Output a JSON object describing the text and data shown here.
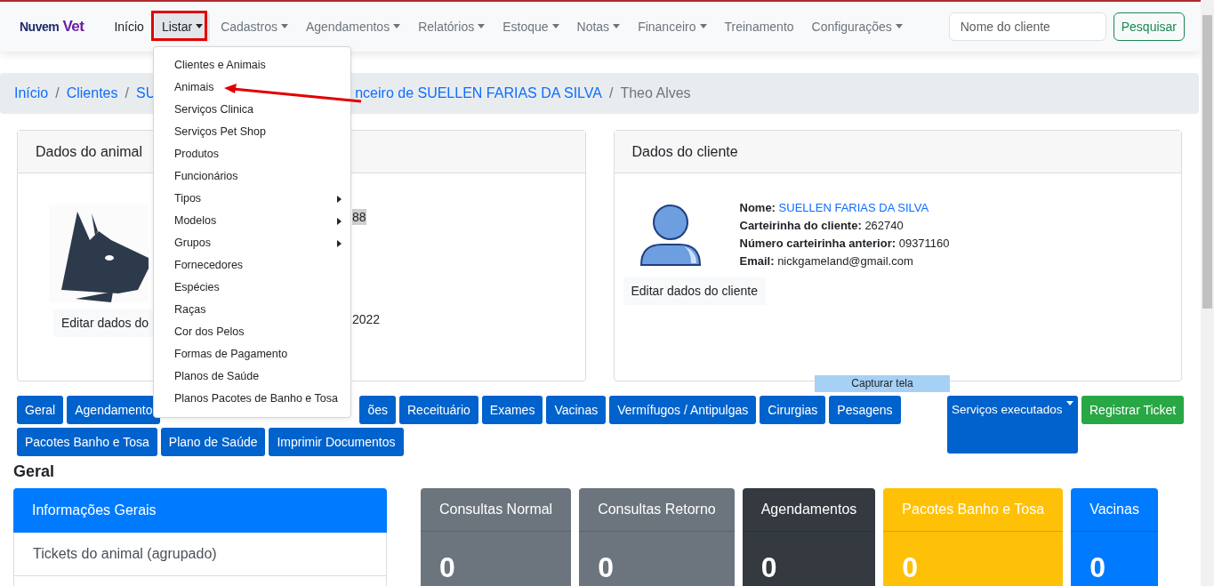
{
  "navbar": {
    "brand": {
      "first": "Nuvem",
      "second": "Vet"
    },
    "items": [
      {
        "label": "Início",
        "dropdown": false,
        "active": true,
        "open": false
      },
      {
        "label": "Listar",
        "dropdown": true,
        "active": true,
        "open": true
      },
      {
        "label": "Cadastros",
        "dropdown": true,
        "active": false,
        "open": false
      },
      {
        "label": "Agendamentos",
        "dropdown": true,
        "active": false,
        "open": false
      },
      {
        "label": "Relatórios",
        "dropdown": true,
        "active": false,
        "open": false
      },
      {
        "label": "Estoque",
        "dropdown": true,
        "active": false,
        "open": false
      },
      {
        "label": "Notas",
        "dropdown": true,
        "active": false,
        "open": false
      },
      {
        "label": "Financeiro",
        "dropdown": true,
        "active": false,
        "open": false
      },
      {
        "label": "Treinamento",
        "dropdown": false,
        "active": false,
        "open": false
      },
      {
        "label": "Configurações",
        "dropdown": true,
        "active": false,
        "open": false
      }
    ],
    "search": {
      "placeholder": "Nome do cliente"
    },
    "search_button": "Pesquisar"
  },
  "dropdown_menu": {
    "items": [
      {
        "label": "Clientes e Animais",
        "submenu": false
      },
      {
        "label": "Animais",
        "submenu": false
      },
      {
        "label": "Serviços Clinica",
        "submenu": false
      },
      {
        "label": "Serviços Pet Shop",
        "submenu": false
      },
      {
        "label": "Produtos",
        "submenu": false
      },
      {
        "label": "Funcionários",
        "submenu": false
      },
      {
        "label": "Tipos",
        "submenu": true
      },
      {
        "label": "Modelos",
        "submenu": true
      },
      {
        "label": "Grupos",
        "submenu": true
      },
      {
        "label": "Fornecedores",
        "submenu": false
      },
      {
        "label": "Espécies",
        "submenu": false
      },
      {
        "label": "Raças",
        "submenu": false
      },
      {
        "label": "Cor dos Pelos",
        "submenu": false
      },
      {
        "label": "Formas de Pagamento",
        "submenu": false
      },
      {
        "label": "Planos de Saúde",
        "submenu": false
      },
      {
        "label": "Planos Pacotes de Banho e Tosa",
        "submenu": false
      }
    ]
  },
  "breadcrumb": {
    "separator": "/",
    "items": [
      {
        "label": "Início",
        "link": true
      },
      {
        "label": "Clientes",
        "link": true
      },
      {
        "label": "SU",
        "link": true
      },
      {
        "label": "nceiro de SUELLEN FARIAS DA SILVA",
        "link": true
      },
      {
        "label": "Theo Alves",
        "link": false
      }
    ]
  },
  "animal_card": {
    "title": "Dados do animal",
    "fields": [
      {
        "text": "88",
        "highlighted": true
      },
      {
        "text": "2022",
        "highlighted": false
      }
    ],
    "edit_button": "Editar dados do"
  },
  "client_card": {
    "title": "Dados do cliente",
    "fields": [
      {
        "label": "Nome:",
        "value": "SUELLEN FARIAS DA SILVA",
        "link": true
      },
      {
        "label": "Carteirinha do cliente:",
        "value": "262740",
        "link": false
      },
      {
        "label": "Número carteirinha anterior:",
        "value": "09371160",
        "link": false
      },
      {
        "label": "Email:",
        "value": "nickgameland@gmail.com",
        "link": false
      }
    ],
    "edit_button": "Editar dados do cliente"
  },
  "action_buttons": {
    "first_line": [
      {
        "label": "Geral"
      },
      {
        "label": "Agendamento"
      },
      {
        "label": "ões"
      },
      {
        "label": "Receituário"
      },
      {
        "label": "Exames"
      },
      {
        "label": "Vacinas"
      },
      {
        "label": "Vermífugos / Antipulgas"
      },
      {
        "label": "Cirurgias"
      },
      {
        "label": "Pesagens"
      }
    ],
    "second_line": [
      {
        "label": "Pacotes Banho e Tosa"
      },
      {
        "label": "Plano de Saúde"
      },
      {
        "label": "Imprimir Documentos"
      }
    ],
    "side": [
      {
        "label": "Serviços executados",
        "kind": "dropdown"
      },
      {
        "label": "Registrar Ticket",
        "kind": "success"
      }
    ]
  },
  "tooltip": "Capturar tela",
  "section_title": "Geral",
  "info_list": {
    "header": "Informações Gerais",
    "items": [
      "Tickets do animal (agrupado)"
    ]
  },
  "stat_cards": [
    {
      "title": "Consultas Normal",
      "value": "0",
      "color": "#6c757d"
    },
    {
      "title": "Consultas Retorno",
      "value": "0",
      "color": "#6c757d"
    },
    {
      "title": "Agendamentos",
      "value": "0",
      "color": "#343a40"
    },
    {
      "title": "Pacotes Banho e Tosa",
      "value": "0",
      "color": "#ffc107"
    },
    {
      "title": "Vacinas",
      "value": "0",
      "color": "#007bff"
    }
  ]
}
